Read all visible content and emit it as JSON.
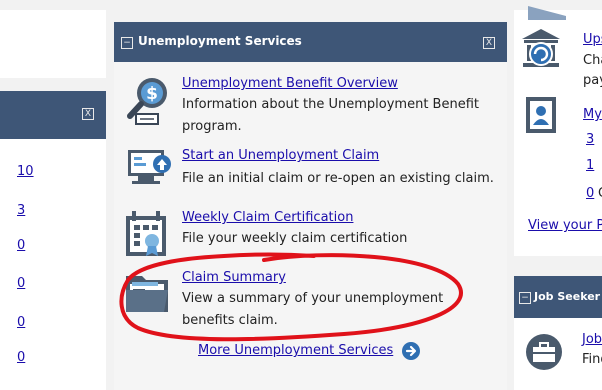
{
  "left": {
    "close_glyph": "X",
    "counts": [
      "10",
      "3",
      "0",
      "0",
      "0",
      "0"
    ]
  },
  "center": {
    "title": "Unemployment Services",
    "collapse_glyph": "−",
    "close_glyph": "X",
    "services": [
      {
        "title": "Unemployment Benefit Overview",
        "desc": "Information about the Unemployment Benefit program.",
        "icon": "benefit-overview-icon"
      },
      {
        "title": "Start an Unemployment Claim",
        "desc": "File an initial claim or re-open an existing claim.",
        "icon": "start-claim-icon"
      },
      {
        "title": "Weekly Claim Certification",
        "desc": "File your weekly claim certification",
        "icon": "weekly-certification-icon"
      },
      {
        "title": "Claim Summary",
        "desc": "View a summary of your unemployment benefits claim.",
        "icon": "claim-summary-icon"
      }
    ],
    "more_link": "More Unemployment Services"
  },
  "right": {
    "item1_title": "Ups",
    "item1_line2": "Cha",
    "item1_line3": "pay",
    "item2_title": "My",
    "item2_counts": [
      "3",
      "1",
      "0"
    ],
    "item2_count3_suffix": "C",
    "view_link": "View your P",
    "panel_title": "Job Seeker",
    "collapse_glyph": "−",
    "job_title": "Job",
    "job_desc": "Find"
  },
  "colors": {
    "header": "#3e5677",
    "link": "#1a0dab",
    "annotation": "#e0121a"
  }
}
